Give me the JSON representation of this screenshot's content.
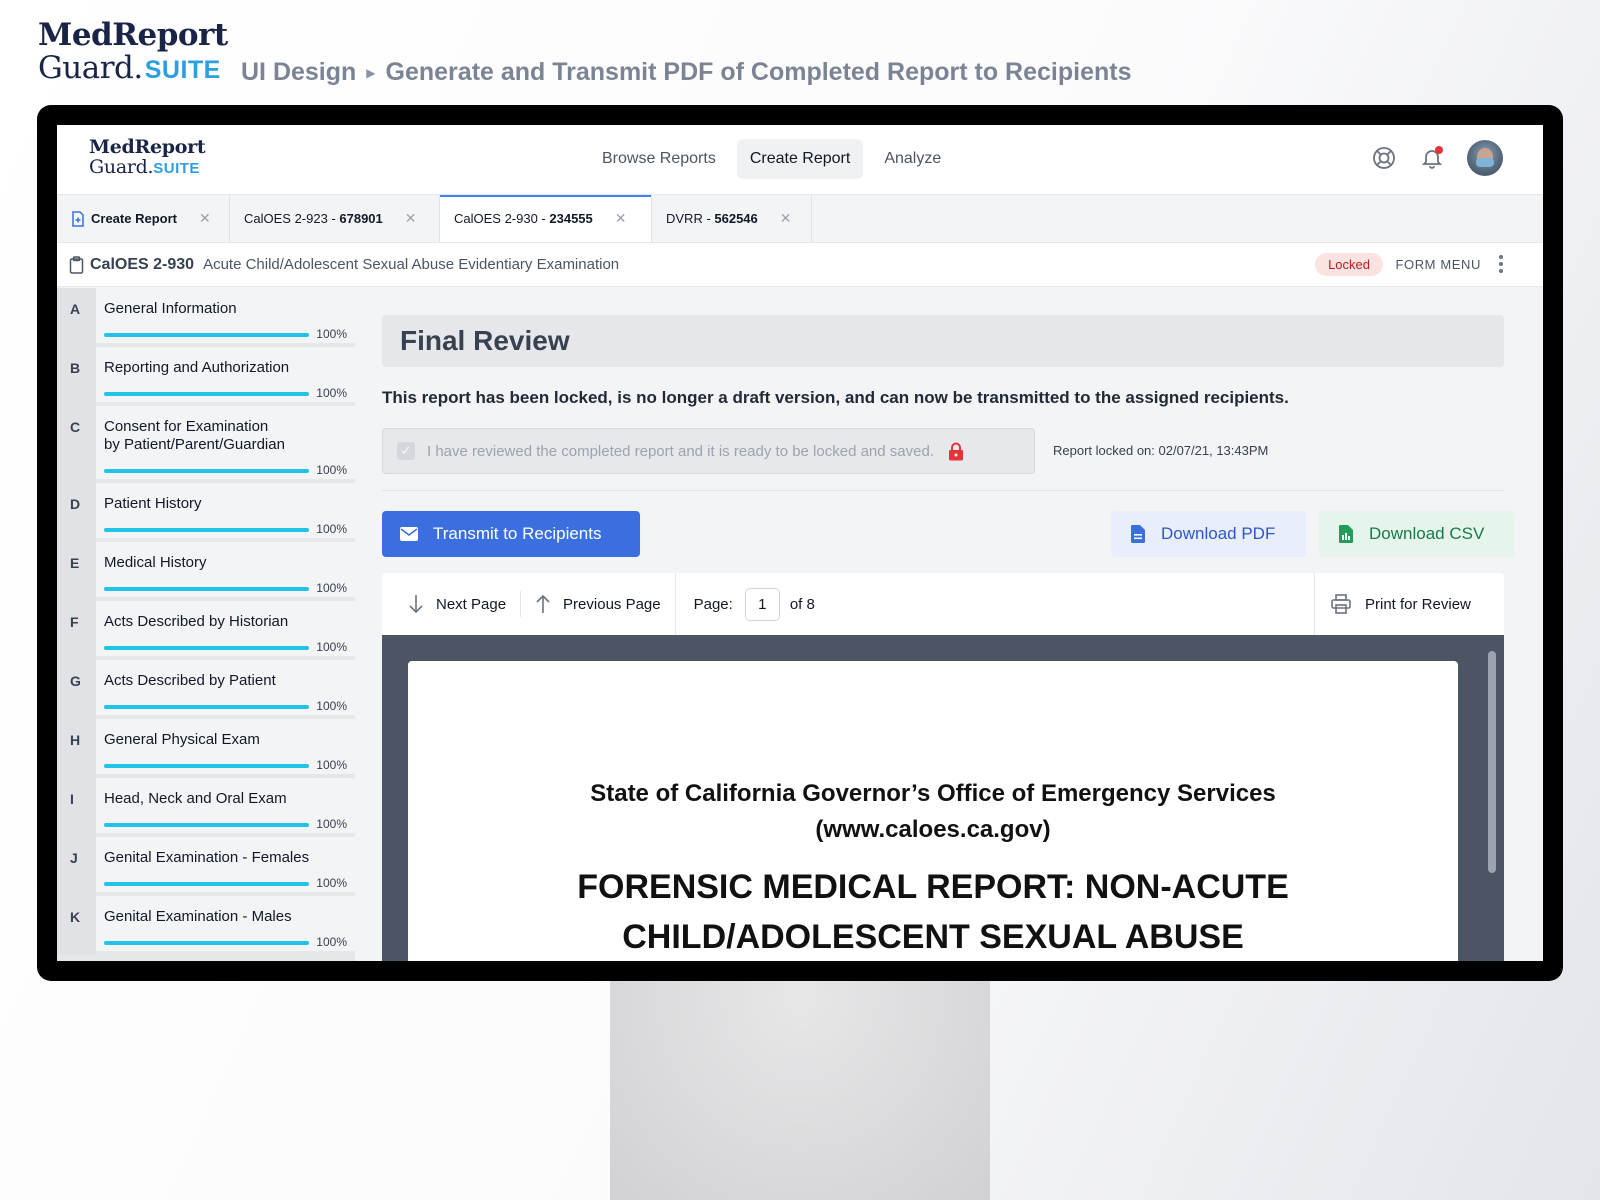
{
  "presentation": {
    "logo_line1": "MedReport",
    "logo_line2": "Guard.",
    "logo_suite": "SUITE",
    "crumb_1": "UI Design",
    "crumb_2": "Generate and Transmit PDF of Completed Report to Recipients"
  },
  "app": {
    "logo_line1": "MedReport",
    "logo_line2": "Guard.",
    "logo_suite": "SUITE",
    "nav": [
      "Browse Reports",
      "Create Report",
      "Analyze"
    ],
    "nav_active": "Create Report"
  },
  "tabs": [
    {
      "prefix": "Create Report",
      "id": "",
      "active": false
    },
    {
      "prefix": "CalOES 2-923 - ",
      "id": "678901",
      "active": false
    },
    {
      "prefix": "CalOES 2-930 - ",
      "id": "234555",
      "active": true
    },
    {
      "prefix": "DVRR - ",
      "id": "562546",
      "active": false
    }
  ],
  "form": {
    "code": "CalOES 2-930",
    "title": "Acute Child/Adolescent Sexual Abuse Evidentiary Examination",
    "status": "Locked",
    "menu_label": "FORM MENU"
  },
  "sections": [
    {
      "letter": "A",
      "label": "General Information",
      "progress": "100%"
    },
    {
      "letter": "B",
      "label": "Reporting and Authorization",
      "progress": "100%"
    },
    {
      "letter": "C",
      "label": "Consent for Examination\nby Patient/Parent/Guardian",
      "progress": "100%"
    },
    {
      "letter": "D",
      "label": "Patient History",
      "progress": "100%"
    },
    {
      "letter": "E",
      "label": "Medical History",
      "progress": "100%"
    },
    {
      "letter": "F",
      "label": "Acts Described by Historian",
      "progress": "100%"
    },
    {
      "letter": "G",
      "label": "Acts Described by Patient",
      "progress": "100%"
    },
    {
      "letter": "H",
      "label": "General Physical Exam",
      "progress": "100%"
    },
    {
      "letter": "I",
      "label": "Head, Neck and Oral Exam",
      "progress": "100%"
    },
    {
      "letter": "J",
      "label": "Genital Examination - Females",
      "progress": "100%"
    },
    {
      "letter": "K",
      "label": "Genital Examination - Males",
      "progress": "100%"
    }
  ],
  "review": {
    "title": "Final Review",
    "description": "This report has been locked, is no longer a draft version, and can now be transmitted to the assigned recipients.",
    "confirm_text": "I have reviewed the completed report and it is ready to be locked and saved.",
    "locked_on": "Report locked on: 02/07/21, 13:43PM",
    "transmit_label": "Transmit to Recipients",
    "download_pdf_label": "Download PDF",
    "download_csv_label": "Download CSV"
  },
  "viewer": {
    "next_label": "Next Page",
    "prev_label": "Previous Page",
    "page_label": "Page:",
    "page_value": "1",
    "of_label": "of 8",
    "print_label": "Print for Review",
    "doc_line1": "State of California Governor’s Office of Emergency Services",
    "doc_line2": "(www.caloes.ca.gov)",
    "doc_line3": "FORENSIC MEDICAL REPORT: NON-ACUTE",
    "doc_line4": "CHILD/ADOLESCENT SEXUAL ABUSE"
  },
  "colors": {
    "primary": "#3b6fe0",
    "progress": "#22c3e6",
    "locked_badge_bg": "#fde2e2",
    "locked_badge_text": "#b91c1c",
    "csv_green": "#167a4a",
    "suite_blue": "#2b9fe0"
  }
}
